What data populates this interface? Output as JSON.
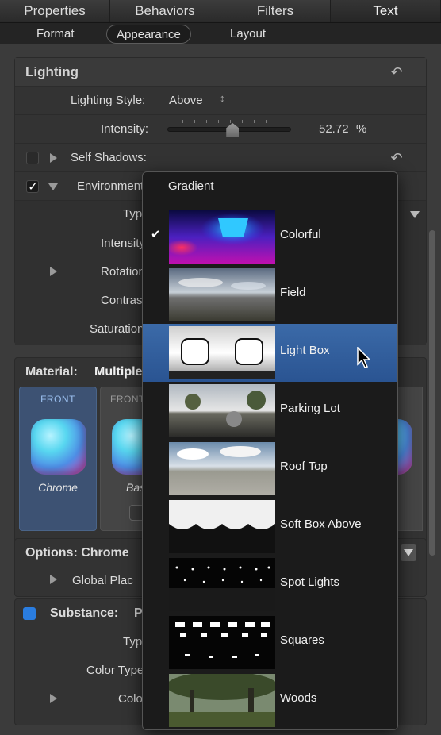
{
  "top_tabs": [
    "Properties",
    "Behaviors",
    "Filters",
    "Text"
  ],
  "sub_tabs": [
    "Format",
    "Appearance",
    "Layout"
  ],
  "lighting": {
    "title": "Lighting",
    "style_label": "Lighting Style:",
    "style_value": "Above",
    "intensity_label": "Intensity:",
    "intensity_value": "52.72",
    "intensity_unit": "%",
    "intensity_fraction": 0.5272,
    "self_shadows_label": "Self Shadows:",
    "environment_label": "Environment",
    "type_label": "Type",
    "intensity2_label": "Intensity",
    "rotation_label": "Rotation",
    "contrast_label": "Contrast",
    "saturation_label": "Saturation"
  },
  "material": {
    "title": "Material:",
    "value": "Multiple",
    "cards": [
      {
        "label": "FRONT",
        "name": "Chrome"
      },
      {
        "label": "FRONT",
        "name": "Bas"
      }
    ]
  },
  "options": {
    "title": "Options: Chrome",
    "global_label": "Global Plac"
  },
  "substance": {
    "title": "Substance:",
    "value": "P",
    "type_label": "Type",
    "color_type_label": "Color Type",
    "color_label": "Colo"
  },
  "popup": {
    "header": "Gradient",
    "items": [
      {
        "label": "Colorful",
        "checked": true,
        "selected": false,
        "thumb": "colorful"
      },
      {
        "label": "Field",
        "checked": false,
        "selected": false,
        "thumb": "field"
      },
      {
        "label": "Light Box",
        "checked": false,
        "selected": true,
        "thumb": "lightbox"
      },
      {
        "label": "Parking Lot",
        "checked": false,
        "selected": false,
        "thumb": "parking"
      },
      {
        "label": "Roof Top",
        "checked": false,
        "selected": false,
        "thumb": "roof"
      },
      {
        "label": "Soft Box Above",
        "checked": false,
        "selected": false,
        "thumb": "softbox"
      },
      {
        "label": "Spot Lights",
        "checked": false,
        "selected": false,
        "thumb": "spot"
      },
      {
        "label": "Squares",
        "checked": false,
        "selected": false,
        "thumb": "squares"
      },
      {
        "label": "Woods",
        "checked": false,
        "selected": false,
        "thumb": "woods"
      }
    ]
  },
  "colors": {
    "accent": "#2f5c9c",
    "checkbox_blue": "#2a7de0"
  }
}
